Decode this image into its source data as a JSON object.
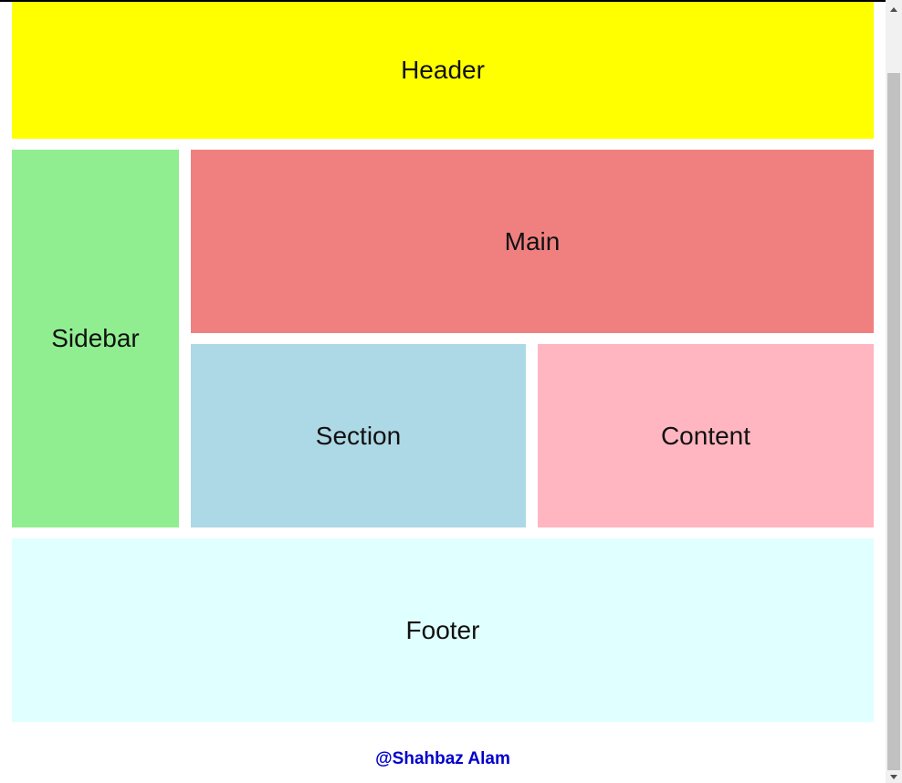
{
  "layout": {
    "header": {
      "label": "Header",
      "color": "#ffff00"
    },
    "sidebar": {
      "label": "Sidebar",
      "color": "#90ee90"
    },
    "main": {
      "label": "Main",
      "color": "#f08080"
    },
    "section": {
      "label": "Section",
      "color": "#add8e6"
    },
    "content": {
      "label": "Content",
      "color": "#ffb6c1"
    },
    "footer": {
      "label": "Footer",
      "color": "#e0ffff"
    }
  },
  "credit": {
    "text": "@Shahbaz Alam",
    "color": "#0000cc"
  },
  "scrollbar": {
    "up_icon": "triangle-up-icon",
    "down_icon": "triangle-down-icon"
  }
}
